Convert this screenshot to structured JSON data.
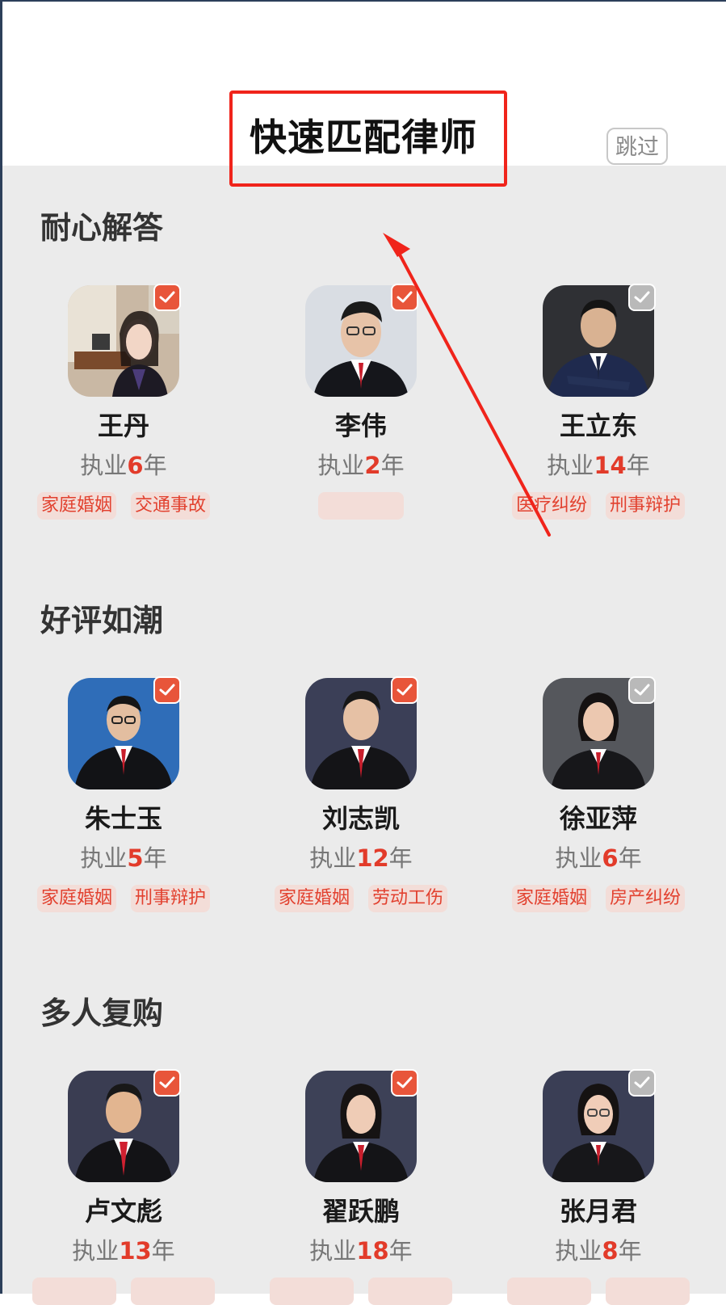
{
  "header": {
    "title": "快速匹配律师",
    "skip_label": "跳过"
  },
  "sections": [
    {
      "title": "耐心解答",
      "lawyers": [
        {
          "name": "王丹",
          "practice_prefix": "执业",
          "years": "6",
          "practice_suffix": "年",
          "tags": [
            "家庭婚姻",
            "交通事故"
          ],
          "selected": true
        },
        {
          "name": "李伟",
          "practice_prefix": "执业",
          "years": "2",
          "practice_suffix": "年",
          "tags": [
            ""
          ],
          "selected": true
        },
        {
          "name": "王立东",
          "practice_prefix": "执业",
          "years": "14",
          "practice_suffix": "年",
          "tags": [
            "医疗纠纷",
            "刑事辩护"
          ],
          "selected": false
        }
      ]
    },
    {
      "title": "好评如潮",
      "lawyers": [
        {
          "name": "朱士玉",
          "practice_prefix": "执业",
          "years": "5",
          "practice_suffix": "年",
          "tags": [
            "家庭婚姻",
            "刑事辩护"
          ],
          "selected": true
        },
        {
          "name": "刘志凯",
          "practice_prefix": "执业",
          "years": "12",
          "practice_suffix": "年",
          "tags": [
            "家庭婚姻",
            "劳动工伤"
          ],
          "selected": true
        },
        {
          "name": "徐亚萍",
          "practice_prefix": "执业",
          "years": "6",
          "practice_suffix": "年",
          "tags": [
            "家庭婚姻",
            "房产纠纷"
          ],
          "selected": false
        }
      ]
    },
    {
      "title": "多人复购",
      "lawyers": [
        {
          "name": "卢文彪",
          "practice_prefix": "执业",
          "years": "13",
          "practice_suffix": "年",
          "tags": [],
          "selected": true
        },
        {
          "name": "翟跃鹏",
          "practice_prefix": "执业",
          "years": "18",
          "practice_suffix": "年",
          "tags": [],
          "selected": true
        },
        {
          "name": "张月君",
          "practice_prefix": "执业",
          "years": "8",
          "practice_suffix": "年",
          "tags": [],
          "selected": false
        }
      ]
    }
  ],
  "colors": {
    "accent": "#e23b2a",
    "badge_on": "#e8553a",
    "badge_off": "#b9b9b9",
    "tag_bg": "#f3ddd8",
    "panel_bg": "#ebebeb",
    "annotation_red": "#f0241b"
  },
  "icons": {
    "check": "check-icon",
    "avatar": "lawyer-portrait"
  }
}
